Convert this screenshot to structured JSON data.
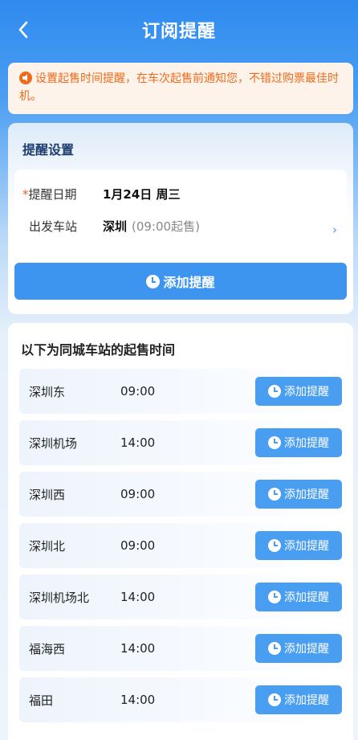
{
  "header": {
    "title": "订阅提醒"
  },
  "notice": {
    "text": "设置起售时间提醒，在车次起售前通知您，不错过购票最佳时机。"
  },
  "settings": {
    "title": "提醒设置",
    "date_label": "提醒日期",
    "date_required_mark": "*",
    "date_value": "1月24日 周三",
    "station_label": "出发车站",
    "station_value": "深圳",
    "station_sale": "(09:00起售)",
    "add_button": "添加提醒"
  },
  "list": {
    "title": "以下为同城车站的起售时间",
    "button_label": "添加提醒",
    "stations": [
      {
        "name": "深圳东",
        "time": "09:00"
      },
      {
        "name": "深圳机场",
        "time": "14:00"
      },
      {
        "name": "深圳西",
        "time": "09:00"
      },
      {
        "name": "深圳北",
        "time": "09:00"
      },
      {
        "name": "深圳机场北",
        "time": "14:00"
      },
      {
        "name": "福海西",
        "time": "14:00"
      },
      {
        "name": "福田",
        "time": "14:00"
      }
    ]
  },
  "colors": {
    "primary": "#3d95ef",
    "notice": "#ef6a1a"
  }
}
